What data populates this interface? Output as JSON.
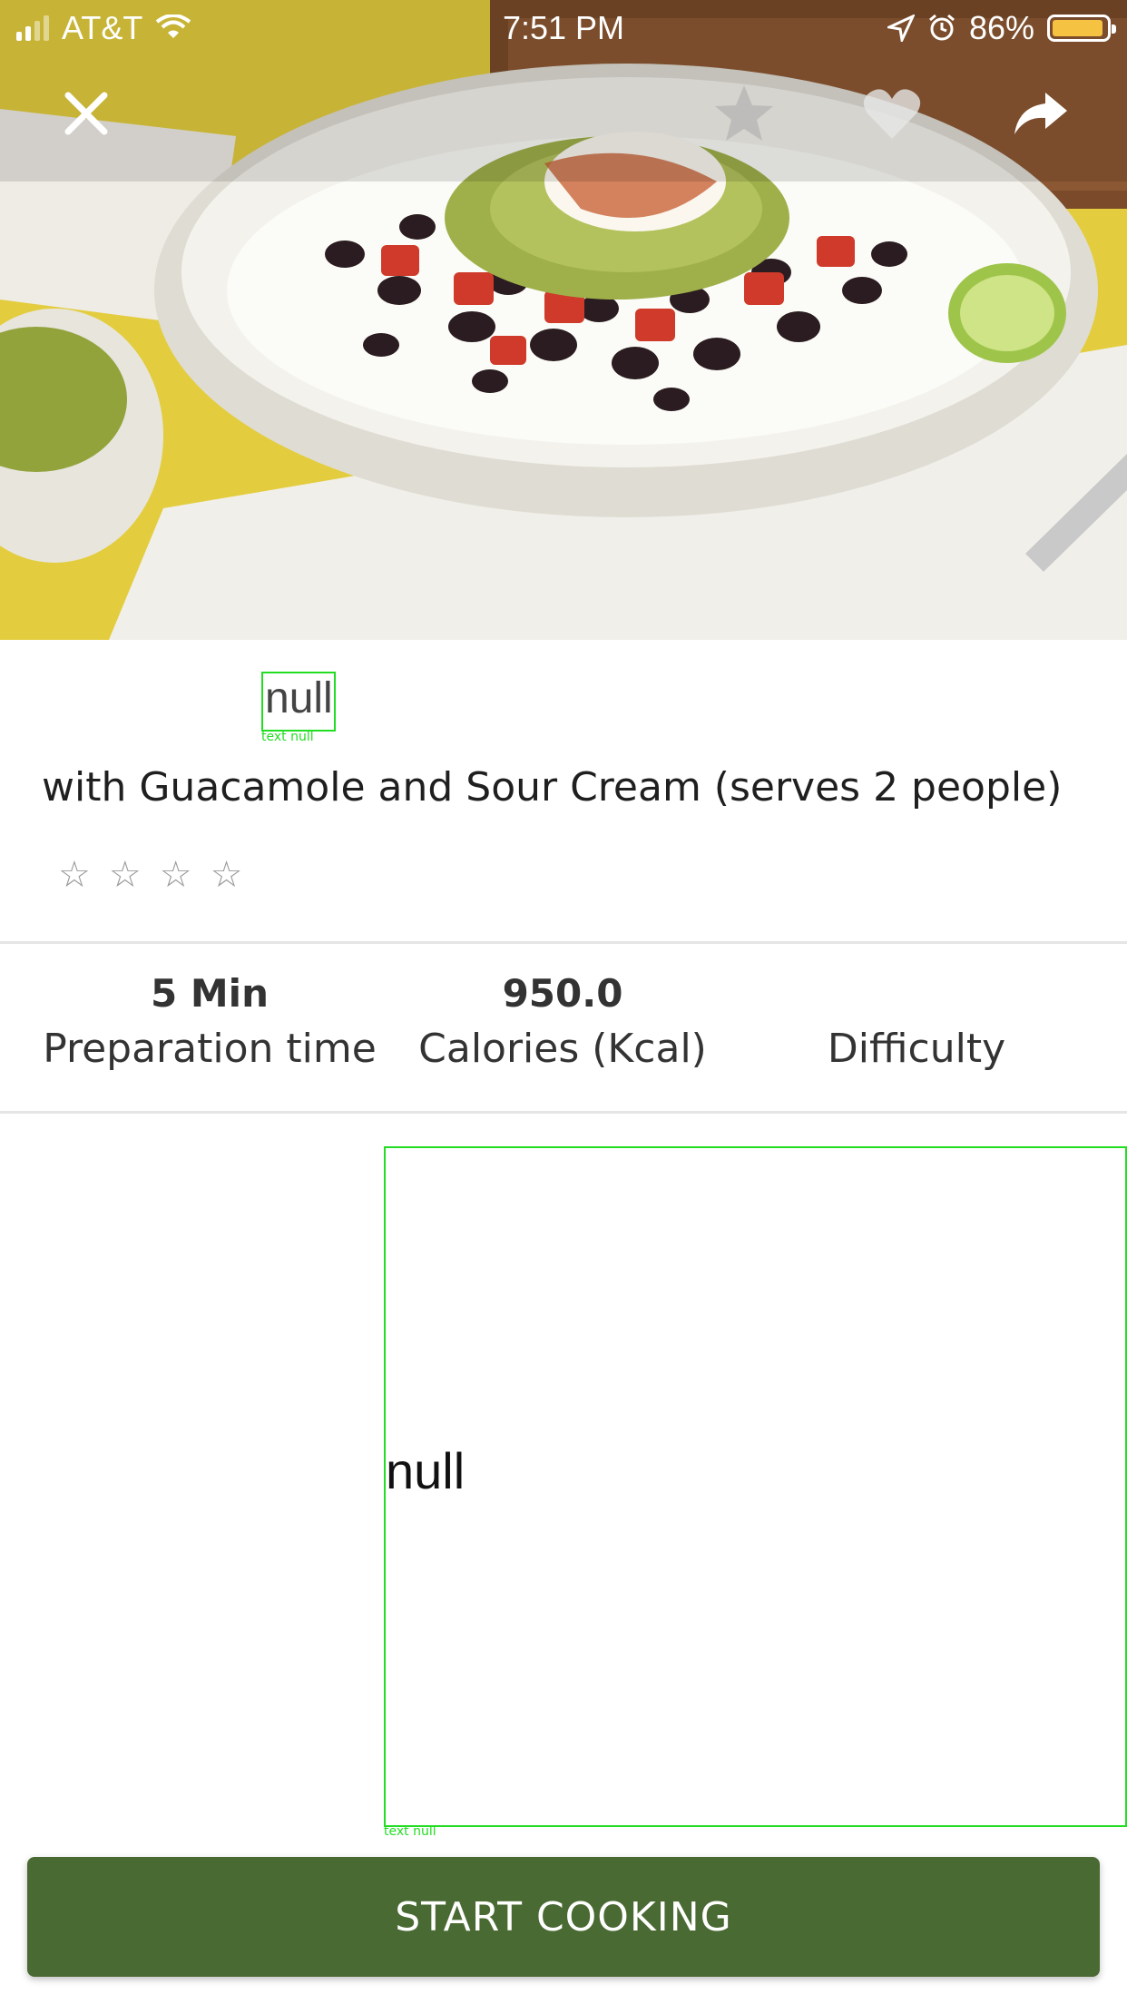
{
  "status_bar": {
    "carrier": "AT&T",
    "time": "7:51 PM",
    "battery": "86%"
  },
  "top_actions": {
    "close_icon": "close-icon",
    "star_icon": "star-icon",
    "heart_icon": "heart-icon",
    "share_icon": "share-icon"
  },
  "recipe": {
    "title": "null",
    "title_debug_tag": "text null",
    "subtitle": "with Guacamole and Sour Cream (serves 2 people)",
    "rating": 0,
    "rating_max": 4,
    "star_glyph": "☆"
  },
  "stats": [
    {
      "value": "5 Min",
      "label": "Preparation time"
    },
    {
      "value": "950.0",
      "label": "Calories (Kcal)"
    },
    {
      "value": "",
      "label": "Difficulty"
    }
  ],
  "content": {
    "null_text": "null",
    "debug_tag": "text null"
  },
  "cta": {
    "label": "START COOKING"
  },
  "colors": {
    "accent": "#4a6a33",
    "debug_outline": "#22dd22",
    "battery": "#f5c242"
  }
}
